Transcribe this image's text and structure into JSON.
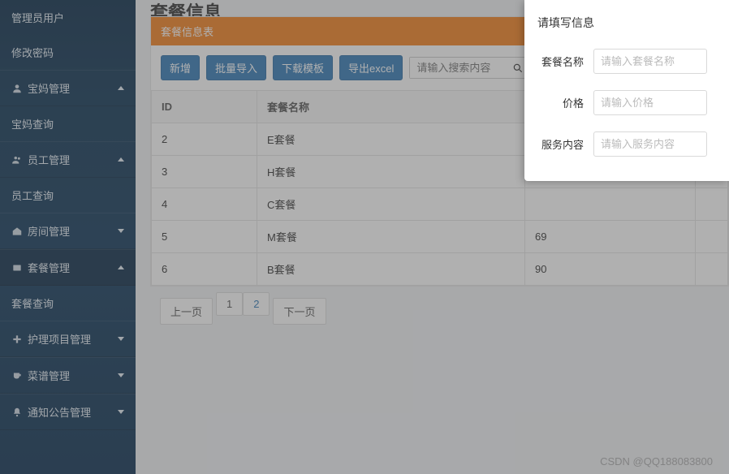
{
  "sidebar": {
    "links": [
      {
        "label": "管理员用户"
      },
      {
        "label": "修改密码"
      }
    ],
    "groups": [
      {
        "label": "宝妈管理",
        "icon": "user-icon",
        "expanded": true,
        "children": [
          {
            "label": "宝妈查询"
          }
        ]
      },
      {
        "label": "员工管理",
        "icon": "team-icon",
        "expanded": true,
        "children": [
          {
            "label": "员工查询"
          }
        ]
      },
      {
        "label": "房间管理",
        "icon": "home-icon",
        "expanded": false,
        "children": []
      },
      {
        "label": "套餐管理",
        "icon": "package-icon",
        "expanded": true,
        "children": [
          {
            "label": "套餐查询"
          }
        ]
      },
      {
        "label": "护理项目管理",
        "icon": "plus-icon",
        "expanded": false,
        "children": []
      },
      {
        "label": "菜谱管理",
        "icon": "cup-icon",
        "expanded": false,
        "children": []
      },
      {
        "label": "通知公告管理",
        "icon": "bell-icon",
        "expanded": false,
        "children": []
      }
    ]
  },
  "page": {
    "title": "套餐信息"
  },
  "panel": {
    "title": "套餐信息表"
  },
  "toolbar": {
    "add": "新增",
    "batch_import": "批量导入",
    "download_template": "下载模板",
    "export_excel": "导出excel",
    "search_placeholder": "请输入搜索内容"
  },
  "table": {
    "columns": {
      "id": "ID",
      "name": "套餐名称",
      "price": ""
    },
    "rows": [
      {
        "id": "2",
        "name": "E套餐",
        "price": ""
      },
      {
        "id": "3",
        "name": "H套餐",
        "price": ""
      },
      {
        "id": "4",
        "name": "C套餐",
        "price": ""
      },
      {
        "id": "5",
        "name": "M套餐",
        "price": "69"
      },
      {
        "id": "6",
        "name": "B套餐",
        "price": "90"
      }
    ]
  },
  "pager": {
    "prev": "上一页",
    "next": "下一页",
    "pages": [
      "1",
      "2"
    ],
    "current": "2"
  },
  "modal": {
    "title": "请填写信息",
    "fields": {
      "name": {
        "label": "套餐名称",
        "placeholder": "请输入套餐名称"
      },
      "price": {
        "label": "价格",
        "placeholder": "请输入价格"
      },
      "service": {
        "label": "服务内容",
        "placeholder": "请输入服务内容"
      }
    }
  },
  "watermark": "CSDN @QQ188083800"
}
